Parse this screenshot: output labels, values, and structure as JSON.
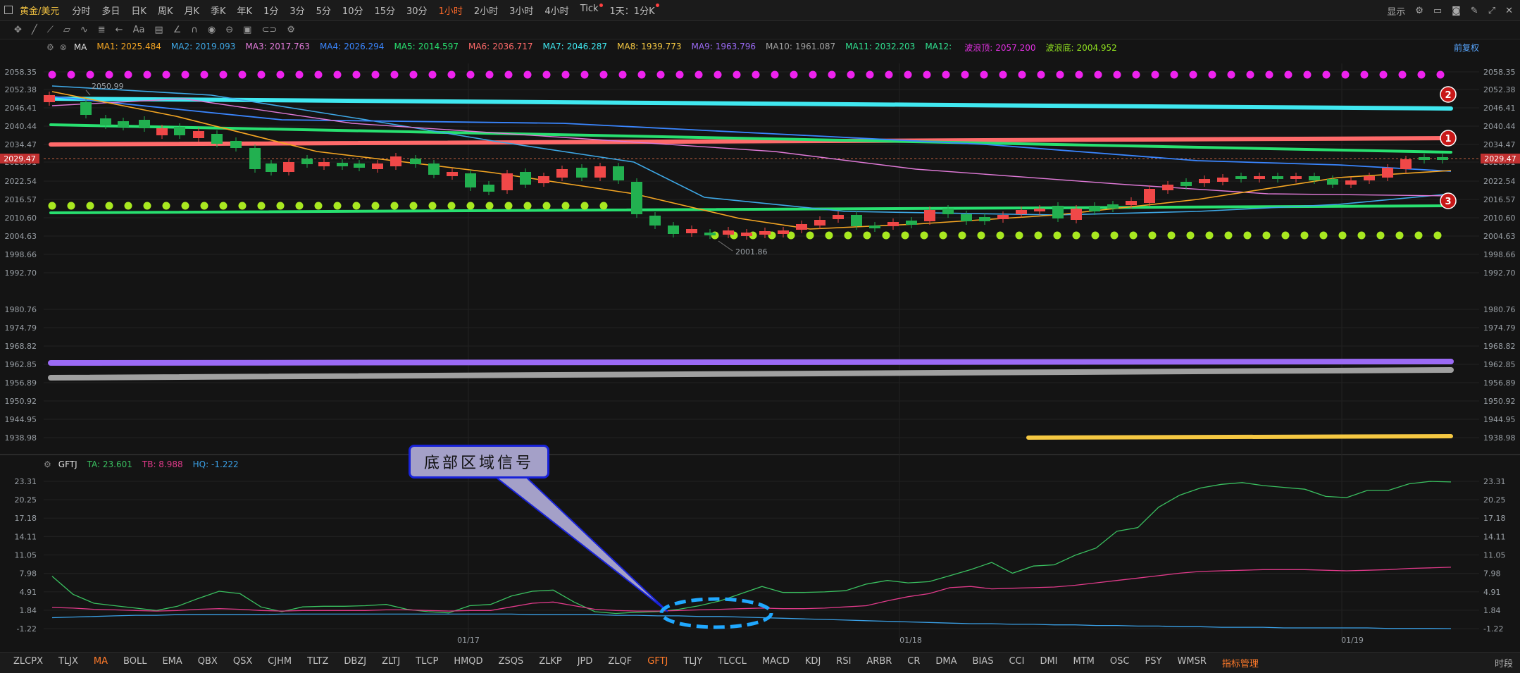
{
  "header": {
    "symbol": "黄金/美元",
    "timeframes": [
      "分时",
      "多日",
      "日K",
      "周K",
      "月K",
      "季K",
      "年K",
      "1分",
      "3分",
      "5分",
      "10分",
      "15分",
      "30分",
      "1小时",
      "2小时",
      "3小时",
      "4小时",
      "Tick",
      "1天：1分K"
    ],
    "active_timeframe": "1小时",
    "display_label": "显示"
  },
  "ma_legend": {
    "name": "MA",
    "items": [
      {
        "label": "MA1:",
        "value": "2025.484",
        "color": "#f5a623"
      },
      {
        "label": "MA2:",
        "value": "2019.093",
        "color": "#3ea8e6"
      },
      {
        "label": "MA3:",
        "value": "2017.763",
        "color": "#e07ad8"
      },
      {
        "label": "MA4:",
        "value": "2026.294",
        "color": "#3a86ff"
      },
      {
        "label": "MA5:",
        "value": "2014.597",
        "color": "#28e070"
      },
      {
        "label": "MA6:",
        "value": "2036.717",
        "color": "#ff6a6a"
      },
      {
        "label": "MA7:",
        "value": "2046.287",
        "color": "#40e8f0"
      },
      {
        "label": "MA8:",
        "value": "1939.773",
        "color": "#f5c842"
      },
      {
        "label": "MA9:",
        "value": "1963.796",
        "color": "#9b6af5"
      },
      {
        "label": "MA10:",
        "value": "1961.087",
        "color": "#a0a0a0"
      },
      {
        "label": "MA11:",
        "value": "2032.203",
        "color": "#30e090"
      },
      {
        "label": "MA12:",
        "value": "",
        "color": "#30e090"
      },
      {
        "label": "波浪顶:",
        "value": "2057.200",
        "color": "#e030e0"
      },
      {
        "label": "波浪底:",
        "value": "2004.952",
        "color": "#90e020"
      }
    ],
    "adjust_label": "前复权"
  },
  "price_axis": {
    "ticks": [
      "2058.35",
      "2052.38",
      "2046.41",
      "2040.44",
      "2034.47",
      "2028.51",
      "2022.54",
      "2016.57",
      "2010.60",
      "2004.63",
      "1998.66",
      "1992.70",
      "1980.76",
      "1974.79",
      "1968.82",
      "1962.85",
      "1956.89",
      "1950.92",
      "1944.95",
      "1938.98"
    ],
    "last_price": "2029.47",
    "high_label": "2050.99",
    "low_label": "2001.86"
  },
  "markers": [
    "1",
    "2",
    "3"
  ],
  "gftj_legend": {
    "name": "GFTJ",
    "items": [
      {
        "label": "TA:",
        "value": "23.601",
        "color": "#3ac060"
      },
      {
        "label": "TB:",
        "value": "8.988",
        "color": "#e03a8a"
      },
      {
        "label": "HQ:",
        "value": "-1.222",
        "color": "#3aa0e6"
      }
    ]
  },
  "gftj_axis": {
    "ticks": [
      "23.31",
      "20.25",
      "17.18",
      "14.11",
      "11.05",
      "7.98",
      "4.91",
      "1.84",
      "-1.22"
    ]
  },
  "date_labels": [
    "01/17",
    "01/18",
    "01/19"
  ],
  "callout": {
    "text": "底部区域信号"
  },
  "bottom_tabs": [
    "ZLCPX",
    "TLJX",
    "MA",
    "BOLL",
    "EMA",
    "QBX",
    "QSX",
    "CJHM",
    "TLTZ",
    "DBZJ",
    "ZLTJ",
    "TLCP",
    "HMQD",
    "ZSQS",
    "ZLKP",
    "JPD",
    "ZLQF",
    "GFTJ",
    "TLJY",
    "TLCCL",
    "MACD",
    "KDJ",
    "RSI",
    "ARBR",
    "CR",
    "DMA",
    "BIAS",
    "CCI",
    "DMI",
    "MTM",
    "OSC",
    "PSY",
    "WMSR",
    "指标管理"
  ],
  "active_tabs": [
    "MA",
    "GFTJ",
    "指标管理"
  ],
  "bottom_right": "时段",
  "chart_data": [
    {
      "type": "candlestick",
      "title": "黄金/美元 1小时",
      "ylim": [
        1935,
        2060
      ],
      "series": [
        {
          "name": "MA6",
          "values": [
            2034.8,
            2036.4
          ],
          "color": "#ff6a6a"
        },
        {
          "name": "MA7",
          "values": [
            2050.5,
            2046.3
          ],
          "color": "#40e8f0"
        },
        {
          "name": "MA5",
          "values": [
            2012.0,
            2014.6
          ],
          "color": "#28e070"
        },
        {
          "name": "MA9",
          "values": [
            1963.2,
            1963.8
          ],
          "color": "#9b6af5"
        },
        {
          "name": "MA10",
          "values": [
            1958.8,
            1961.1
          ],
          "color": "#a0a0a0"
        },
        {
          "name": "MA8",
          "values": [
            1938.5,
            1939.8
          ],
          "color": "#f5c842"
        },
        {
          "name": "波浪顶",
          "values": [
            2057.2
          ],
          "color": "#e030e0"
        },
        {
          "name": "波浪底",
          "values": [
            2014.8,
            2004.95
          ],
          "color": "#90e020"
        }
      ]
    },
    {
      "type": "line",
      "title": "GFTJ",
      "ylim": [
        -1.22,
        23.31
      ],
      "series": [
        {
          "name": "TA",
          "values": [
            7.5,
            4.5,
            3.0,
            2.6,
            2.2,
            1.8,
            2.5,
            3.8,
            5.0,
            4.6,
            2.4,
            1.6,
            2.4,
            2.5,
            2.5,
            2.6,
            2.8,
            2.0,
            1.6,
            1.4,
            2.6,
            2.8,
            4.2,
            5.0,
            5.2,
            3.2,
            1.6,
            1.3,
            1.5,
            1.6,
            2.0,
            2.6,
            3.4,
            4.6,
            5.8,
            4.8,
            4.8,
            4.9,
            5.1,
            6.2,
            6.8,
            6.4,
            6.6,
            7.6,
            8.6,
            9.8,
            8.0,
            9.2,
            9.4,
            11.0,
            12.2,
            15.0,
            15.6,
            19.0,
            21.0,
            22.2,
            22.8,
            23.1,
            22.6,
            22.3,
            22.0,
            20.8,
            20.6,
            21.8,
            21.8,
            22.9,
            23.3,
            23.2
          ]
        },
        {
          "name": "TB",
          "values": [
            2.3,
            2.2,
            2.0,
            1.9,
            1.8,
            1.7,
            1.8,
            2.0,
            2.1,
            2.0,
            1.8,
            1.7,
            1.8,
            1.8,
            1.8,
            1.8,
            1.9,
            1.9,
            1.8,
            1.7,
            1.8,
            1.8,
            2.4,
            3.0,
            3.2,
            2.6,
            2.0,
            1.8,
            1.7,
            1.7,
            1.8,
            1.9,
            2.0,
            2.1,
            2.2,
            2.1,
            2.1,
            2.2,
            2.4,
            2.6,
            3.4,
            4.1,
            4.6,
            5.6,
            5.8,
            5.4,
            5.5,
            5.6,
            5.7,
            6.0,
            6.4,
            6.8,
            7.2,
            7.6,
            8.0,
            8.3,
            8.4,
            8.5,
            8.6,
            8.6,
            8.6,
            8.5,
            8.4,
            8.5,
            8.6,
            8.8,
            8.9,
            9.0
          ]
        },
        {
          "name": "HQ",
          "values": [
            0.6,
            0.7,
            0.8,
            0.9,
            1.0,
            1.0,
            1.1,
            1.1,
            1.1,
            1.1,
            1.1,
            1.2,
            1.2,
            1.2,
            1.2,
            1.2,
            1.2,
            1.2,
            1.2,
            1.2,
            1.2,
            1.2,
            1.2,
            1.1,
            1.1,
            1.1,
            1.1,
            1.0,
            1.0,
            0.9,
            0.9,
            0.8,
            0.8,
            0.7,
            0.6,
            0.5,
            0.4,
            0.3,
            0.2,
            0.1,
            0.0,
            -0.1,
            -0.2,
            -0.3,
            -0.4,
            -0.4,
            -0.5,
            -0.5,
            -0.6,
            -0.6,
            -0.7,
            -0.7,
            -0.8,
            -0.8,
            -0.9,
            -0.9,
            -1.0,
            -1.0,
            -1.0,
            -1.1,
            -1.1,
            -1.1,
            -1.1,
            -1.1,
            -1.2,
            -1.2,
            -1.2,
            -1.22
          ]
        }
      ]
    }
  ]
}
